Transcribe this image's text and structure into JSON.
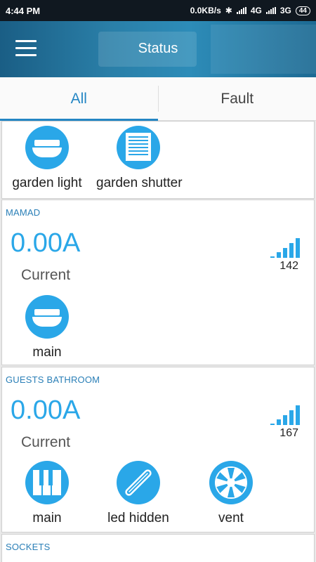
{
  "status_bar": {
    "time": "4:44 PM",
    "speed": "0.0KB/s",
    "net1": "4G",
    "net2": "3G",
    "battery": "44"
  },
  "header": {
    "title": "Status",
    "menu_icon": "hamburger-menu-icon"
  },
  "tabs": [
    {
      "label": "All",
      "active": true
    },
    {
      "label": "Fault",
      "active": false
    }
  ],
  "sections": {
    "top": {
      "devices": [
        {
          "label": "garden light",
          "icon": "ceiling-lamp-icon"
        },
        {
          "label": "garden shutter",
          "icon": "shutter-icon"
        }
      ]
    },
    "mamad": {
      "room": "MAMAD",
      "current_value": "0.00A",
      "current_label": "Current",
      "signal_value": "142",
      "devices": [
        {
          "label": "main",
          "icon": "ceiling-lamp-icon"
        }
      ]
    },
    "guests_bathroom": {
      "room": "GUESTS BATHROOM",
      "current_value": "0.00A",
      "current_label": "Current",
      "signal_value": "167",
      "devices": [
        {
          "label": "main",
          "icon": "switch-panel-icon"
        },
        {
          "label": "led hidden",
          "icon": "led-strip-icon"
        },
        {
          "label": "vent",
          "icon": "fan-icon"
        }
      ]
    },
    "sockets": {
      "room": "SOCKETS"
    }
  },
  "colors": {
    "accent": "#2aa7e8",
    "room_label": "#2a7fb7",
    "appbar": "#2a7fa8"
  }
}
